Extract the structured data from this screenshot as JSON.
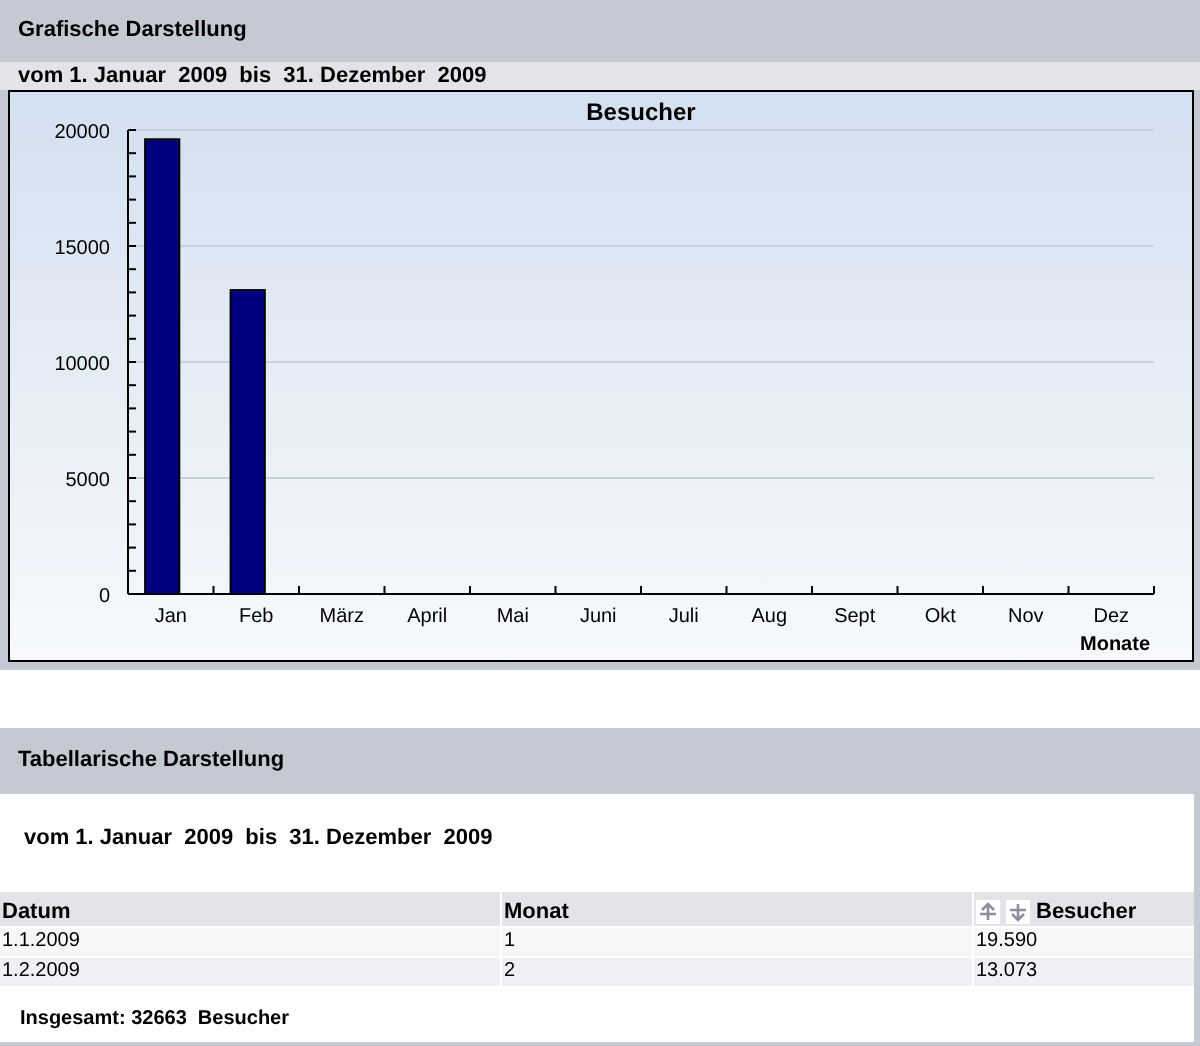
{
  "chart_section": {
    "title": "Grafische Darstellung",
    "period": "vom 1. Januar  2009  bis  31. Dezember  2009",
    "chart_data": {
      "type": "bar",
      "title": "Besucher",
      "xlabel": "Monate",
      "categories": [
        "Jan",
        "Feb",
        "März",
        "April",
        "Mai",
        "Juni",
        "Juli",
        "Aug",
        "Sept",
        "Okt",
        "Nov",
        "Dez"
      ],
      "grid": true,
      "series": [
        {
          "color": "#000080",
          "values": [
            19600,
            13100,
            null,
            null,
            null,
            null,
            null,
            null,
            null,
            null,
            null,
            null
          ]
        }
      ],
      "ylim": [
        0,
        20000
      ],
      "yticks": [
        0,
        5000,
        10000,
        15000,
        20000
      ]
    }
  },
  "table_section": {
    "title": "Tabellarische Darstellung",
    "period": "vom 1. Januar  2009  bis  31. Dezember  2009",
    "columns": [
      "Datum",
      "Monat",
      "Besucher"
    ],
    "rows": [
      [
        "1.1.2009",
        "1",
        "19.590"
      ],
      [
        "1.2.2009",
        "2",
        "13.073"
      ]
    ],
    "total": "Insgesamt: 32663  Besucher"
  }
}
